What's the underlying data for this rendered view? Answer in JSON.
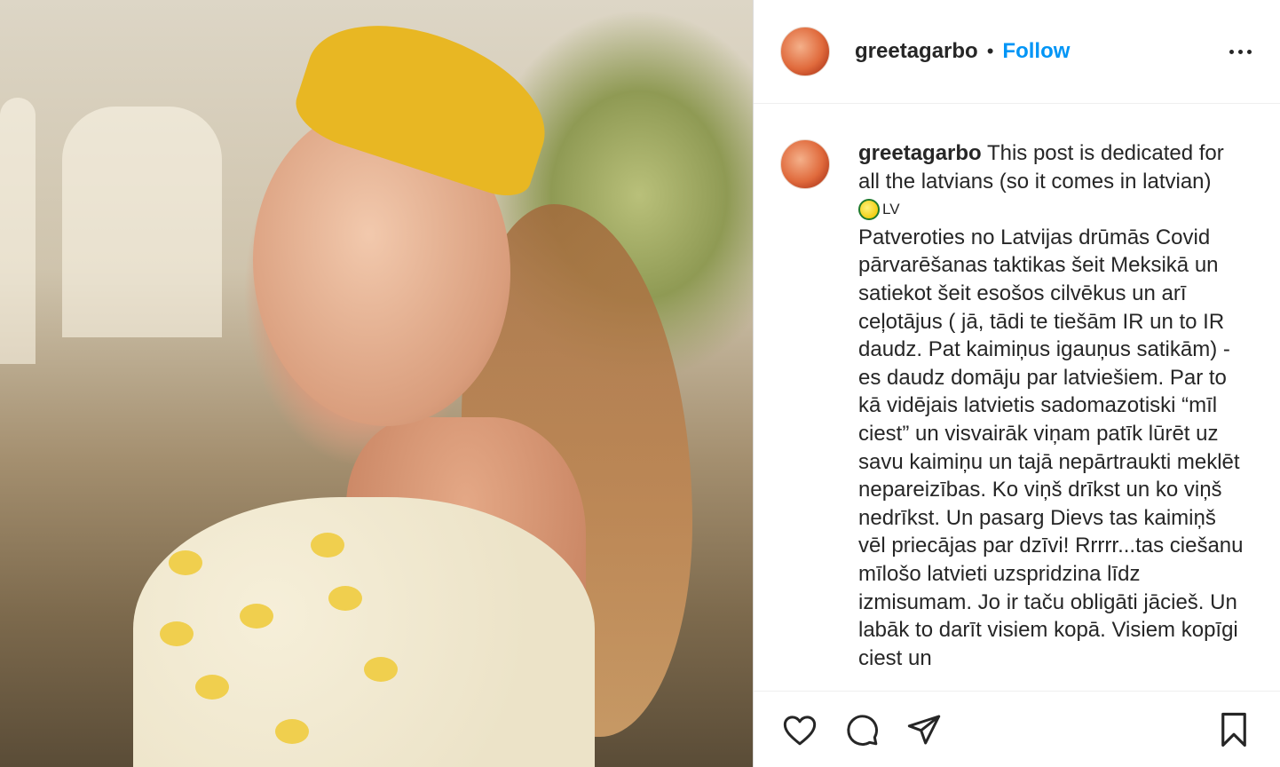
{
  "post": {
    "image_alt": "Woman in a yellow headband looking back over her shoulder",
    "author": {
      "username": "greetagarbo",
      "follow_label": "Follow",
      "separator": "•"
    },
    "caption": {
      "username": "greetagarbo",
      "intro": "This post is dedicated for all the latvians (so it comes in latvian)",
      "flag_code": "LV",
      "body": "Patveroties no Latvijas drūmās Covid pārvarēšanas taktikas šeit Meksikā un satiekot šeit esošos cilvēkus un arī ceļotājus ( jā, tādi te tiešām IR un to IR daudz. Pat kaimiņus igauņus satikām) - es daudz domāju par latviešiem. Par to kā vidējais latvietis sadomazotiski “mīl ciest” un visvairāk viņam patīk lūrēt uz savu kaimiņu un tajā nepārtraukti meklēt nepareizības. Ko viņš drīkst un ko viņš nedrīkst. Un pasarg Dievs tas kaimiņš vēl priecājas par dzīvi! Rrrrr...tas ciešanu mīlošo latvieti uzspridzina līdz izmisumam. Jo ir taču obligāti jācieš. Un labāk to darīt visiem kopā. Visiem kopīgi ciest un"
    },
    "icons": {
      "more": "more-options-icon",
      "like": "heart-icon",
      "comment": "comment-icon",
      "share": "share-icon",
      "save": "bookmark-icon",
      "flag_emoji": "lemon-icon"
    },
    "colors": {
      "follow": "#0095f6",
      "text": "#262626",
      "border": "#dbdbdb"
    }
  }
}
